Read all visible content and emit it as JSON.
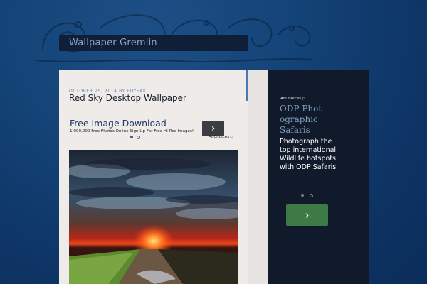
{
  "site": {
    "title": "Wallpaper Gremlin"
  },
  "post": {
    "date": "October 25, 2014",
    "author_prefix": "by",
    "author": "EDYEAK",
    "title": "Red Sky Desktop Wallpaper"
  },
  "ad_top": {
    "title": "Free Image Download",
    "text": "1,000,000 Free Photos Online Sign Up For Free Hi-Res Images!",
    "adchoices": "AdChoices",
    "button_icon": "chevron-right-icon"
  },
  "ad_side": {
    "adchoices": "AdChoices",
    "title": "ODP Photographic Safaris",
    "text": "Photograph the top international Wildlife hotspots with ODP Safaris",
    "button_icon": "chevron-right-icon"
  },
  "colors": {
    "background": "#0e3566",
    "panel": "#eeebe8",
    "sidebar": "#111a2a",
    "accent": "#4a79b0",
    "cta_green": "#3d7a45"
  }
}
